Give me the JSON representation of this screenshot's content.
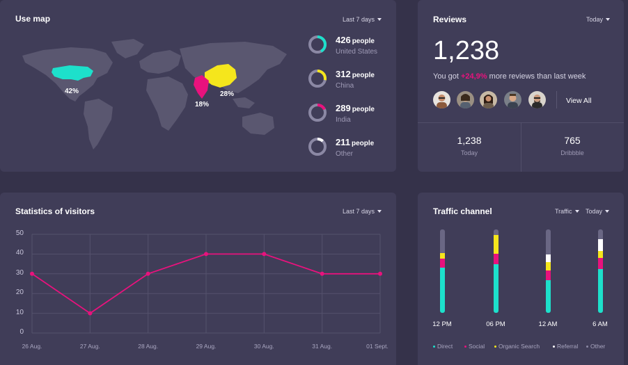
{
  "use_map": {
    "title": "Use map",
    "range": "Last 7 days",
    "map_labels": {
      "us": "42%",
      "china": "28%",
      "india": "18%"
    },
    "stats": [
      {
        "count": "426",
        "unit": "people",
        "label": "United States",
        "fraction": 0.42,
        "color": "#1de0cb"
      },
      {
        "count": "312",
        "unit": "people",
        "label": "China",
        "fraction": 0.28,
        "color": "#f5e61c"
      },
      {
        "count": "289",
        "unit": "people",
        "label": "India",
        "fraction": 0.18,
        "color": "#e8127d"
      },
      {
        "count": "211",
        "unit": "people",
        "label": "Other",
        "fraction": 0.12,
        "color": "#ffffff"
      }
    ]
  },
  "reviews": {
    "title": "Reviews",
    "range": "Today",
    "total": "1,238",
    "sentence_prefix": "You got ",
    "growth": "+24,9%",
    "sentence_suffix": " more reviews than last week",
    "view_all": "View All",
    "today_value": "1,238",
    "today_label": "Today",
    "dribbble_value": "765",
    "dribbble_label": "Dribbble"
  },
  "visitors": {
    "title": "Statistics of visitors",
    "range": "Last 7 days"
  },
  "traffic": {
    "title": "Traffic channel",
    "filter": "Traffic",
    "range": "Today",
    "bars": [
      {
        "label": "12 PM",
        "direct": 62,
        "social": 12,
        "organic": 8,
        "referral": 0,
        "other": 32
      },
      {
        "label": "06 PM",
        "direct": 68,
        "social": 15,
        "organic": 26,
        "referral": 0,
        "other": 8
      },
      {
        "label": "12 AM",
        "direct": 46,
        "social": 14,
        "organic": 12,
        "referral": 11,
        "other": 35
      },
      {
        "label": "6 AM",
        "direct": 62,
        "social": 16,
        "organic": 10,
        "referral": 16,
        "other": 14
      }
    ],
    "legend": [
      {
        "name": "Direct",
        "color": "#1de0cb"
      },
      {
        "name": "Social",
        "color": "#e8127d"
      },
      {
        "name": "Organic Search",
        "color": "#f5e61c"
      },
      {
        "name": "Referral",
        "color": "#ffffff"
      },
      {
        "name": "Other",
        "color": "#8b88a4"
      }
    ]
  },
  "chart_data": {
    "type": "line",
    "categories": [
      "26 Aug.",
      "27 Aug.",
      "28 Aug.",
      "29 Aug.",
      "30 Aug.",
      "31 Aug.",
      "01 Sept."
    ],
    "values": [
      30,
      10,
      30,
      40,
      40,
      30,
      30
    ],
    "yticks": [
      "0",
      "10",
      "20",
      "30",
      "40",
      "50"
    ],
    "ylim": [
      0,
      50
    ],
    "line_color": "#e8127d",
    "grid": true
  }
}
